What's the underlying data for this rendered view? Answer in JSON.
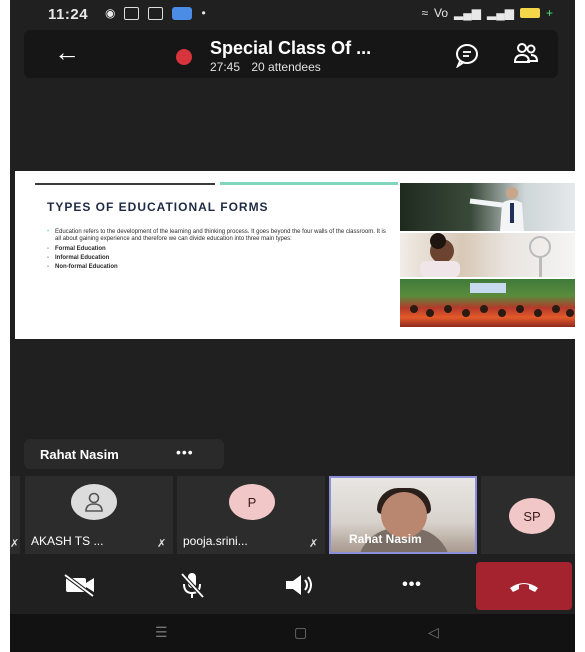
{
  "status_bar": {
    "time": "11:24",
    "left_icons": [
      "notification-icon",
      "sim-icon",
      "message-icon",
      "outlook-icon"
    ],
    "right_icons": [
      "wifi-icon",
      "volte-icon",
      "signal-icon",
      "signal-icon",
      "battery-icon"
    ]
  },
  "header": {
    "title": "Special Class Of ...",
    "duration": "27:45",
    "attendees": "20 attendees",
    "recording_color": "#d8343d"
  },
  "slide": {
    "title": "TYPES OF  EDUCATIONAL FORMS",
    "paragraph": "Education refers to the development of the learning and thinking process. It goes beyond the four walls of the classroom. It is all about gaining experience and therefore we can divide education into three main types:",
    "items": [
      "Formal Education",
      "Informal Education",
      "Non-formal Education"
    ],
    "accent": "#7fd6bd"
  },
  "presenter": {
    "name": "Rahat Nasim",
    "more": "•••"
  },
  "participants": [
    {
      "name": "AKASH TS ...",
      "avatar": "person-icon",
      "muted": true
    },
    {
      "name": "pooja.srini...",
      "initial": "P",
      "muted": true
    },
    {
      "name": "Rahat Nasim",
      "video": true,
      "active": true
    },
    {
      "initial": "SP"
    }
  ],
  "controls": {
    "camera": "camera-off-icon",
    "mic": "mic-off-icon",
    "speaker": "speaker-icon",
    "more": "•••",
    "end_call": "end-call-icon",
    "end_call_color": "#a5232f"
  },
  "nav": [
    "recent-apps-icon",
    "home-icon",
    "back-icon"
  ]
}
